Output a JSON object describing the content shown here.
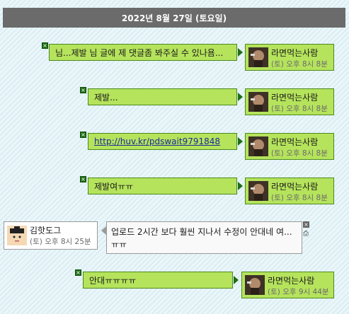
{
  "header": {
    "date": "2022년 8월 27일 (토요일)"
  },
  "messages": [
    {
      "text": "님...제발 님 글에 제 댓글좀 봐주실 수 있나욤...",
      "author": "라면먹는사람",
      "time": "(토) 오후 8시 8분"
    },
    {
      "text": "제발...",
      "author": "라면먹는사람",
      "time": "(토) 오후 8시 8분"
    },
    {
      "link": "http://huv.kr/pdswait9791848",
      "author": "라면먹는사람",
      "time": "(토) 오후 8시 8분"
    },
    {
      "text": "제발여ㅠㅠ",
      "author": "라면먹는사람",
      "time": "(토) 오후 8시 8분"
    },
    {
      "text": "업로드 2시간 보다 훨씬 지나서 수정이 안대네 여... ㅠㅠ",
      "author": "김핫도그",
      "time": "(토) 오후 8시 25분"
    },
    {
      "text": "안대ㅠㅠㅠㅠ",
      "author": "라면먹는사람",
      "time": "(토) 오후 9시 44분"
    }
  ],
  "icons": {
    "delete": "close-icon",
    "print": "print-icon",
    "avatar_ramen": "avatar-icon",
    "avatar_hotdog": "avatar-icon"
  },
  "colors": {
    "bubble": "#b5e35c",
    "bubble_border": "#4a8a1e",
    "header": "#6b6b6b",
    "link": "#1b2c9a"
  }
}
